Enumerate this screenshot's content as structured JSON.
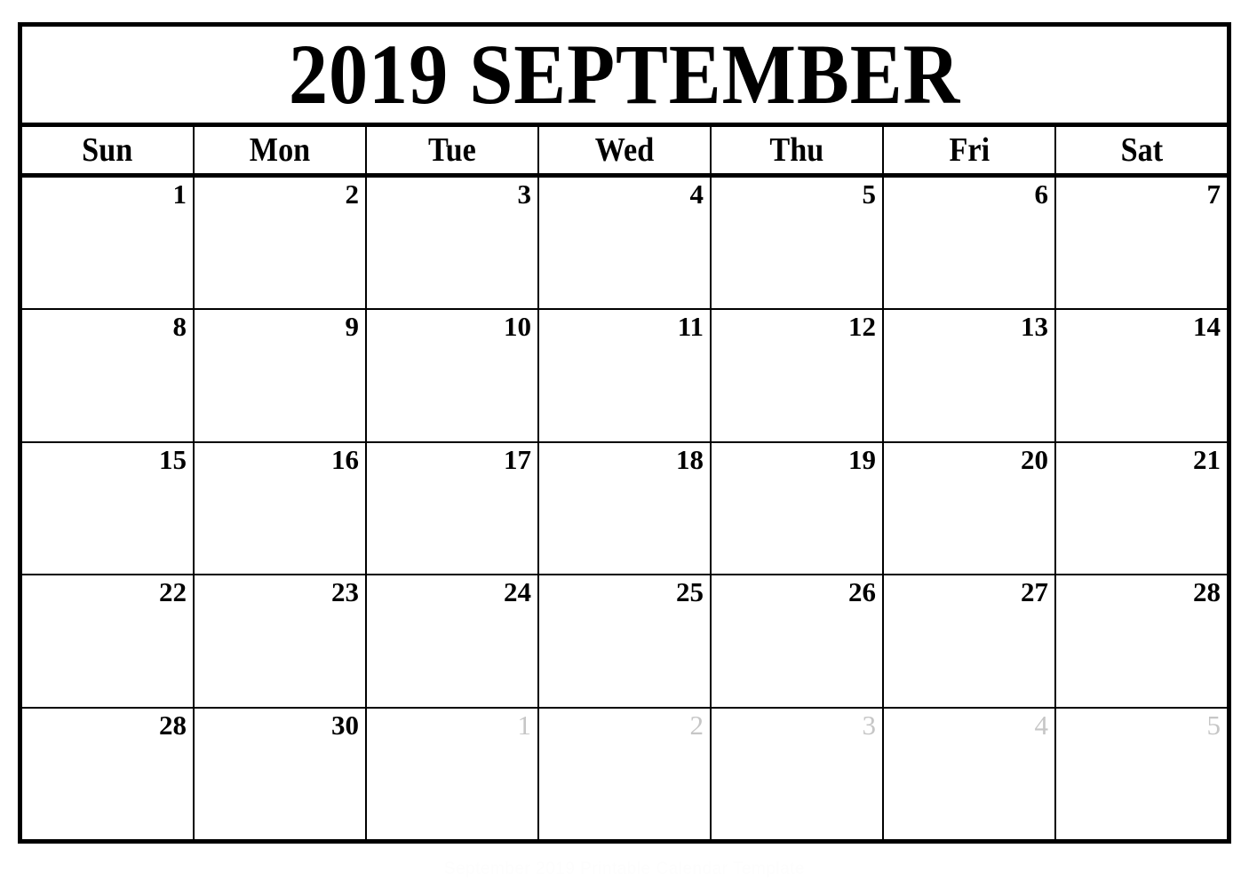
{
  "document": {
    "type": "monthly-calendar",
    "title": "2019 SEPTEMBER",
    "year": "2019",
    "month": "SEPTEMBER"
  },
  "colors": {
    "page_background": "#ffffff",
    "grid_line": "#000000",
    "frame": "#000000",
    "current_month_text": "#000000",
    "other_month_text": "#c6c6c6",
    "watermark_text": "#fdfdfd"
  },
  "weekdays": [
    {
      "label": "Sun"
    },
    {
      "label": "Mon"
    },
    {
      "label": "Tue"
    },
    {
      "label": "Wed"
    },
    {
      "label": "Thu"
    },
    {
      "label": "Fri"
    },
    {
      "label": "Sat"
    }
  ],
  "weeks": [
    {
      "days": [
        {
          "number": "1",
          "muted": false
        },
        {
          "number": "2",
          "muted": false
        },
        {
          "number": "3",
          "muted": false
        },
        {
          "number": "4",
          "muted": false
        },
        {
          "number": "5",
          "muted": false
        },
        {
          "number": "6",
          "muted": false
        },
        {
          "number": "7",
          "muted": false
        }
      ]
    },
    {
      "days": [
        {
          "number": "8",
          "muted": false
        },
        {
          "number": "9",
          "muted": false
        },
        {
          "number": "10",
          "muted": false
        },
        {
          "number": "11",
          "muted": false
        },
        {
          "number": "12",
          "muted": false
        },
        {
          "number": "13",
          "muted": false
        },
        {
          "number": "14",
          "muted": false
        }
      ]
    },
    {
      "days": [
        {
          "number": "15",
          "muted": false
        },
        {
          "number": "16",
          "muted": false
        },
        {
          "number": "17",
          "muted": false
        },
        {
          "number": "18",
          "muted": false
        },
        {
          "number": "19",
          "muted": false
        },
        {
          "number": "20",
          "muted": false
        },
        {
          "number": "21",
          "muted": false
        }
      ]
    },
    {
      "days": [
        {
          "number": "22",
          "muted": false
        },
        {
          "number": "23",
          "muted": false
        },
        {
          "number": "24",
          "muted": false
        },
        {
          "number": "25",
          "muted": false
        },
        {
          "number": "26",
          "muted": false
        },
        {
          "number": "27",
          "muted": false
        },
        {
          "number": "28",
          "muted": false
        }
      ]
    },
    {
      "days": [
        {
          "number": "28",
          "muted": false
        },
        {
          "number": "30",
          "muted": false
        },
        {
          "number": "1",
          "muted": true
        },
        {
          "number": "2",
          "muted": true
        },
        {
          "number": "3",
          "muted": true
        },
        {
          "number": "4",
          "muted": true
        },
        {
          "number": "5",
          "muted": true
        }
      ]
    }
  ],
  "footer": {
    "note": "September 2019 Printable Calendar Template"
  }
}
